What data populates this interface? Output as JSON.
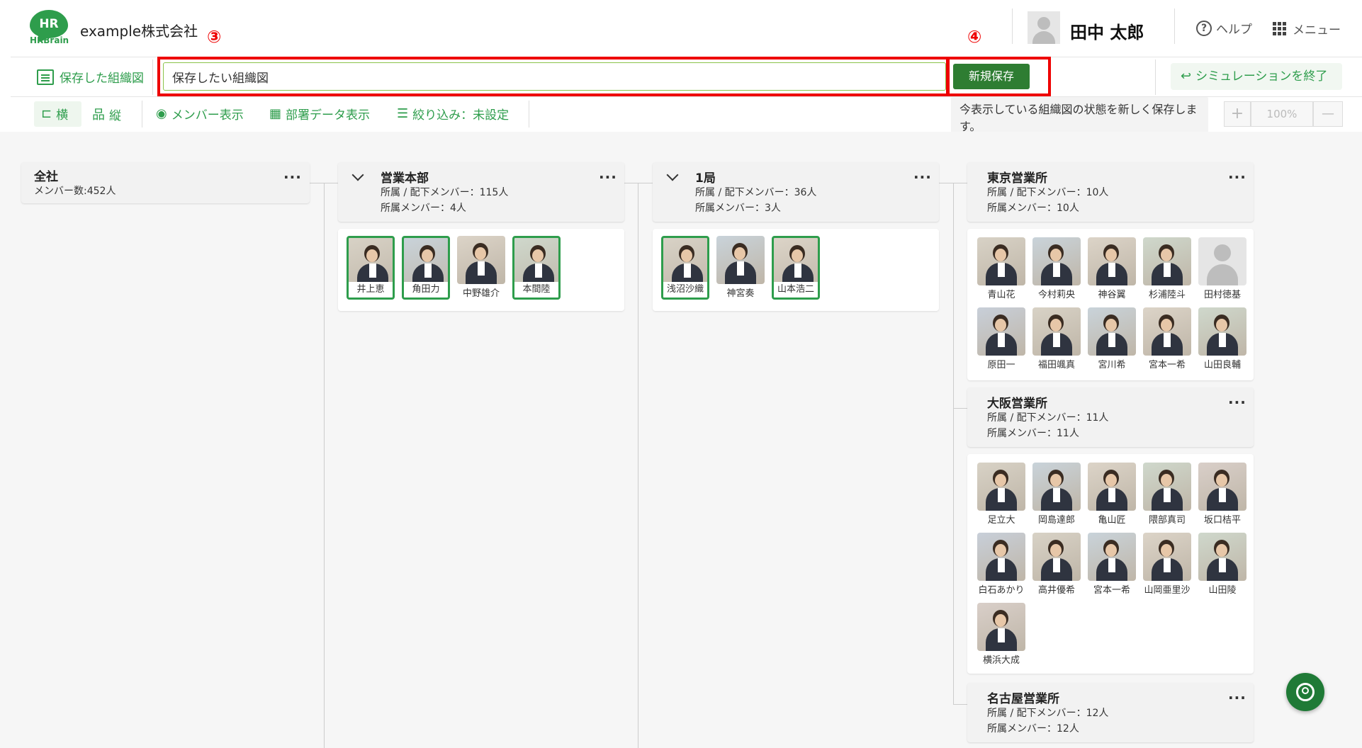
{
  "header": {
    "logo_text": "HR",
    "logo_word": "HRBrain",
    "company": "example株式会社",
    "user_name": "田中 太郎",
    "help_label": "ヘルプ",
    "menu_label": "メニュー"
  },
  "annotations": {
    "marker_3": "③",
    "marker_4": "④"
  },
  "toolbar": {
    "saved_charts_label": "保存した組織図",
    "name_input_value": "保存したい組織図",
    "save_button_label": "新規保存",
    "end_simulation_label": "シミュレーションを終了",
    "tooltip_text": "今表示している組織図の状態を新しく保存します。",
    "horizontal_label": "横",
    "vertical_label": "縦",
    "member_display_label": "メンバー表示",
    "dept_data_label": "部署データ表示",
    "filter_label": "絞り込み：未設定",
    "zoom_in": "+",
    "zoom_value": "100%",
    "zoom_out": "—"
  },
  "org": {
    "all": {
      "title": "全社",
      "members": "メンバー数:452人"
    },
    "sales_hq": {
      "title": "営業本部",
      "sub1": "所属 / 配下メンバー：115人",
      "sub2": "所属メンバー：4人",
      "people": [
        "井上恵",
        "角田力",
        "中野雄介",
        "本間陸"
      ]
    },
    "bureau1": {
      "title": "1局",
      "sub1": "所属 / 配下メンバー：36人",
      "sub2": "所属メンバー：3人",
      "people": [
        "浅沼沙織",
        "神宮奏",
        "山本浩二"
      ]
    },
    "tokyo": {
      "title": "東京営業所",
      "sub1": "所属 / 配下メンバー：10人",
      "sub2": "所属メンバー：10人",
      "people": [
        "青山花",
        "今村莉央",
        "神谷翼",
        "杉浦陸斗",
        "田村徳基",
        "原田一",
        "福田颯真",
        "宮川希",
        "宮本一希",
        "山田良輔"
      ]
    },
    "osaka": {
      "title": "大阪営業所",
      "sub1": "所属 / 配下メンバー：11人",
      "sub2": "所属メンバー：11人",
      "people": [
        "足立大",
        "岡島達郎",
        "亀山匠",
        "隈部真司",
        "坂口桔平",
        "白石あかり",
        "高井優希",
        "宮本一希",
        "山岡亜里沙",
        "山田陵",
        "横浜大成"
      ]
    },
    "nagoya": {
      "title": "名古屋営業所",
      "sub1": "所属 / 配下メンバー：12人",
      "sub2": "所属メンバー：12人"
    }
  },
  "more_icon": "..."
}
